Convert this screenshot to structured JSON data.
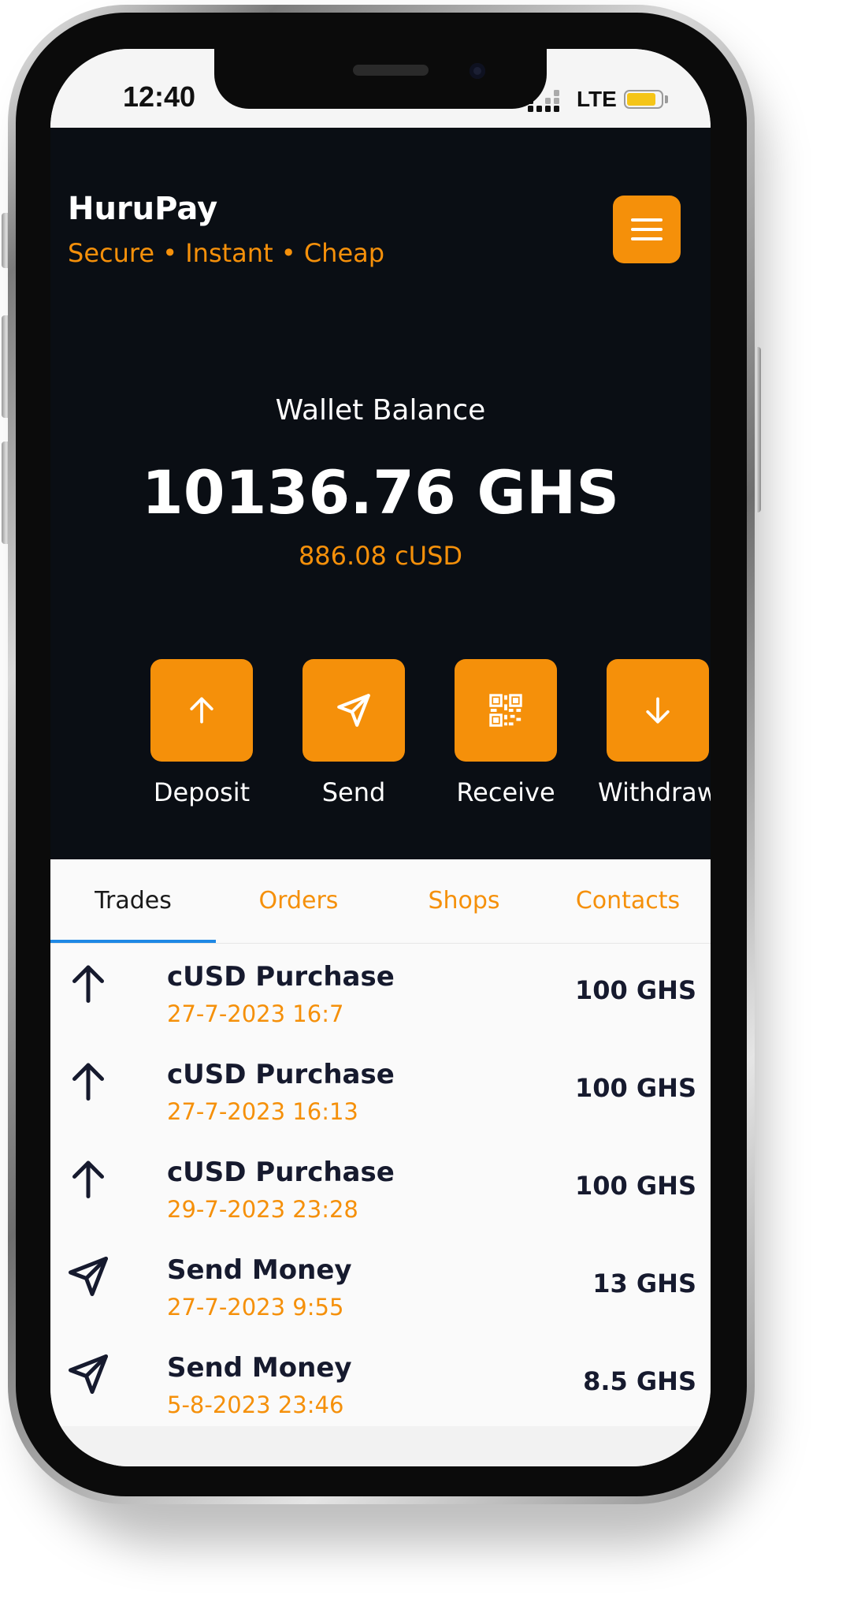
{
  "status_bar": {
    "time": "12:40",
    "network": "LTE",
    "battery_level": 0.85
  },
  "app": {
    "name": "HuruPay",
    "tagline": "Secure • Instant • Cheap",
    "accent_color": "#f5900a",
    "menu_icon": "hamburger-menu-icon"
  },
  "wallet": {
    "label": "Wallet Balance",
    "amount": "10136.76 GHS",
    "secondary": "886.08 cUSD"
  },
  "actions": [
    {
      "label": "Deposit",
      "icon": "arrow-up-icon"
    },
    {
      "label": "Send",
      "icon": "send-icon"
    },
    {
      "label": "Receive",
      "icon": "qr-code-icon"
    },
    {
      "label": "Withdraw",
      "icon": "arrow-down-icon"
    }
  ],
  "tabs": [
    {
      "label": "Trades",
      "active": true
    },
    {
      "label": "Orders",
      "active": false
    },
    {
      "label": "Shops",
      "active": false
    },
    {
      "label": "Contacts",
      "active": false
    }
  ],
  "transactions": [
    {
      "title": "cUSD Purchase",
      "date": "27-7-2023 16:7",
      "amount": "100 GHS",
      "icon": "arrow-up-icon"
    },
    {
      "title": "cUSD Purchase",
      "date": "27-7-2023 16:13",
      "amount": "100 GHS",
      "icon": "arrow-up-icon"
    },
    {
      "title": "cUSD Purchase",
      "date": "29-7-2023 23:28",
      "amount": "100 GHS",
      "icon": "arrow-up-icon"
    },
    {
      "title": "Send Money",
      "date": "27-7-2023 9:55",
      "amount": "13 GHS",
      "icon": "send-icon"
    },
    {
      "title": "Send Money",
      "date": "5-8-2023 23:46",
      "amount": "8.5 GHS",
      "icon": "send-icon"
    }
  ]
}
